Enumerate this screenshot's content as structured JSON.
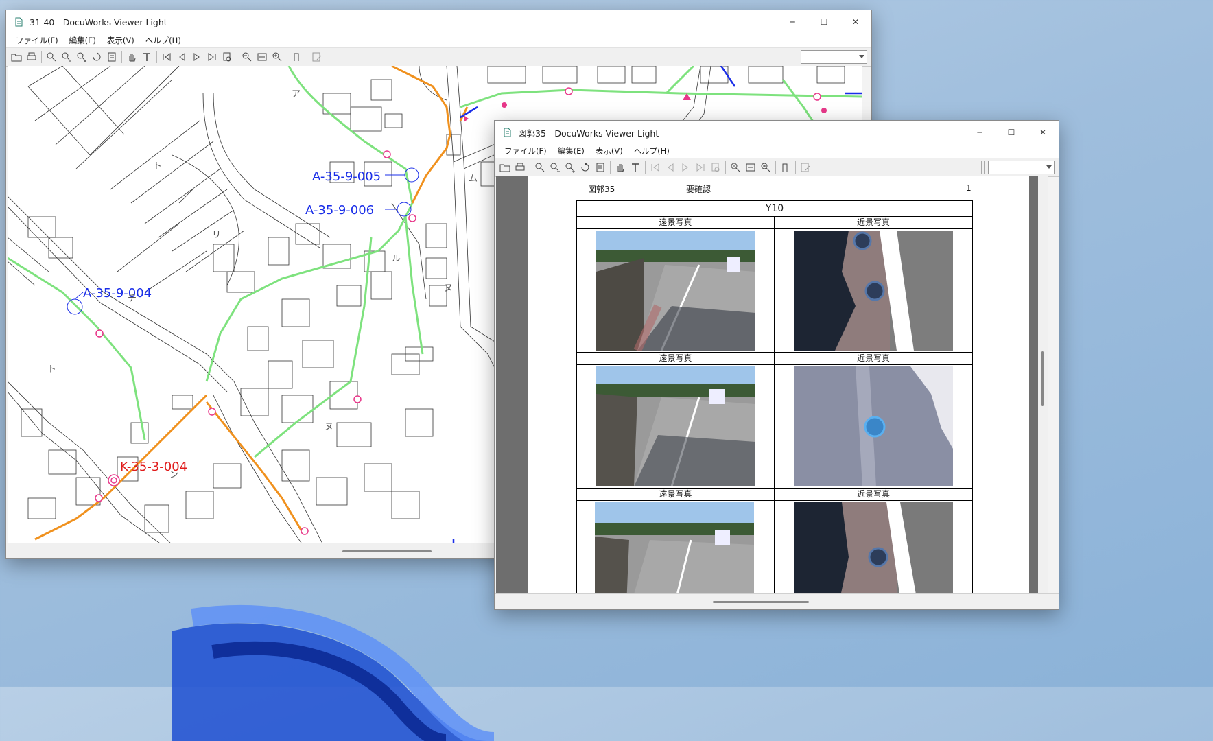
{
  "map_window": {
    "title": "31-40 - DocuWorks Viewer Light",
    "menu": [
      "ファイル(F)",
      "編集(E)",
      "表示(V)",
      "ヘルプ(H)"
    ],
    "labels_blue": [
      "A-35-9-005",
      "A-35-9-006",
      "A-35-9-004"
    ],
    "labels_red": [
      "K-35-3-004"
    ],
    "katakana": [
      "ト",
      "リ",
      "チ",
      "ト",
      "ヌ",
      "ル",
      "ヌ",
      "ン",
      "ア",
      "ム"
    ]
  },
  "doc_window": {
    "title": "図郭35 - DocuWorks Viewer Light",
    "menu": [
      "ファイル(F)",
      "編集(E)",
      "表示(V)",
      "ヘルプ(H)"
    ],
    "header_left": "図郭35",
    "header_mid": "要確認",
    "page_number": "1",
    "table_title": "Y10",
    "col_far": "遠景写真",
    "col_near": "近景写真"
  },
  "window_controls": {
    "minimize": "─",
    "maximize": "☐",
    "close": "✕"
  },
  "colors": {
    "green_line": "#7ee27e",
    "orange_line": "#f0911e",
    "pink_marker": "#e8388a",
    "blue_label": "#1a2ee8",
    "red_label": "#e01b1b"
  }
}
